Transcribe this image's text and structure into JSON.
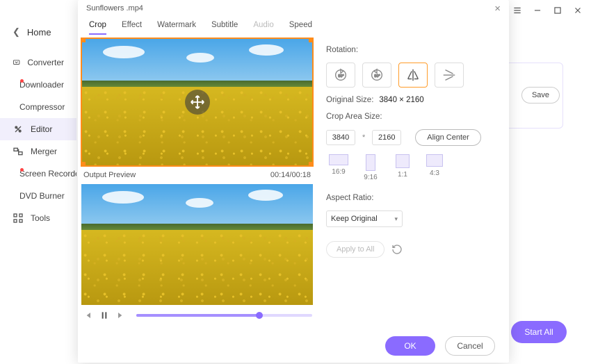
{
  "titlebar": {},
  "sidebar": {
    "home": "Home",
    "items": [
      {
        "label": "Converter"
      },
      {
        "label": "Downloader"
      },
      {
        "label": "Compressor"
      },
      {
        "label": "Editor"
      },
      {
        "label": "Merger"
      },
      {
        "label": "Screen Recorder"
      },
      {
        "label": "DVD Burner"
      },
      {
        "label": "Tools"
      }
    ]
  },
  "main": {
    "save_label": "Save",
    "start_all_label": "Start All"
  },
  "dialog": {
    "title": "Sunflowers .mp4",
    "tabs": [
      {
        "label": "Crop"
      },
      {
        "label": "Effect"
      },
      {
        "label": "Watermark"
      },
      {
        "label": "Subtitle"
      },
      {
        "label": "Audio"
      },
      {
        "label": "Speed"
      }
    ],
    "preview": {
      "output_label": "Output Preview",
      "time": "00:14/00:18"
    },
    "rotation_label": "Rotation:",
    "rot_options": [
      "rotate-cw-90",
      "rotate-ccw-90",
      "flip-horizontal",
      "flip-vertical"
    ],
    "orig_size_label": "Original Size:",
    "orig_size_value": "3840 × 2160",
    "crop_size_label": "Crop Area Size:",
    "crop_w": "3840",
    "crop_h": "2160",
    "align_center_label": "Align Center",
    "ratios": [
      {
        "label": "16:9"
      },
      {
        "label": "9:16"
      },
      {
        "label": "1:1"
      },
      {
        "label": "4:3"
      }
    ],
    "aspect_label": "Aspect Ratio:",
    "aspect_value": "Keep Original",
    "apply_all_label": "Apply to All",
    "footer": {
      "ok": "OK",
      "cancel": "Cancel"
    }
  }
}
